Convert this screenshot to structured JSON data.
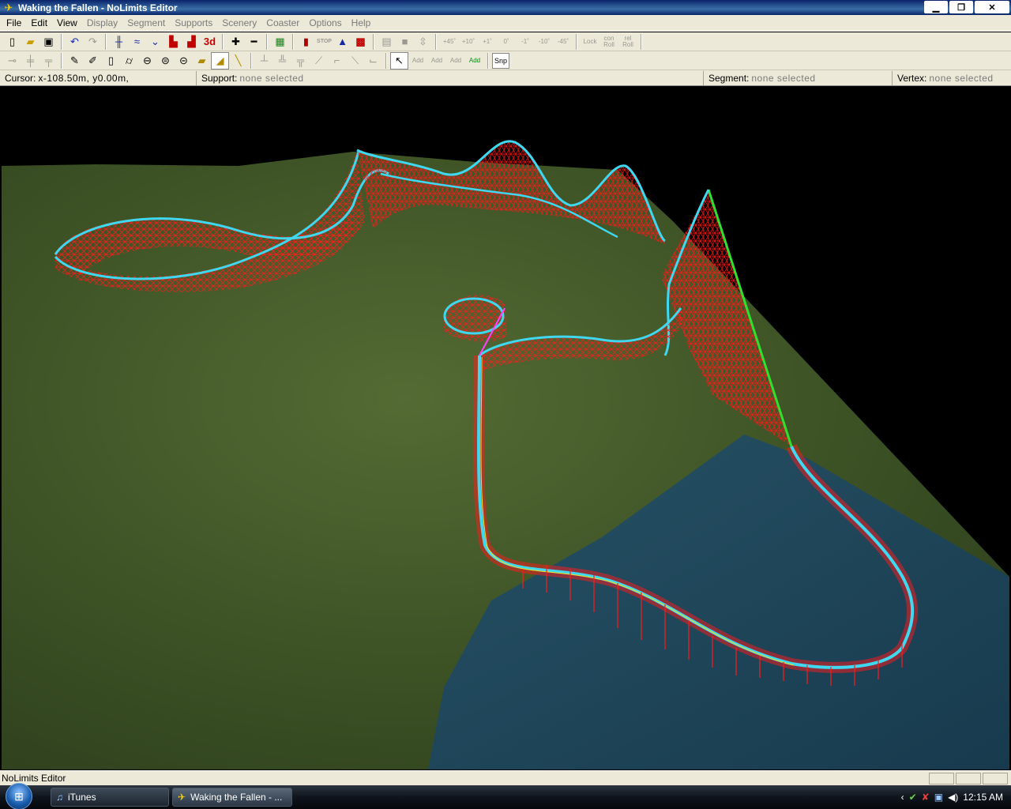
{
  "window": {
    "title": "Waking the Fallen - NoLimits Editor",
    "minimize": "▁",
    "restore": "❐",
    "close": "✕"
  },
  "menu": [
    "File",
    "Edit",
    "View",
    "Display",
    "Segment",
    "Supports",
    "Scenery",
    "Coaster",
    "Options",
    "Help"
  ],
  "toolbar1": {
    "new": "🗋",
    "open": "📂",
    "save": "💾",
    "undo": "↶",
    "redo": "↷",
    "three_d": "3d",
    "stop": "STOP",
    "lock_label": "Lock",
    "con_roll": "con Roll",
    "rel_roll": "rel Roll",
    "angles": [
      "+45˚",
      "+10˚",
      "+1˚",
      "0˚",
      "-1˚",
      "-10˚",
      "-45˚"
    ]
  },
  "toolbar2": {
    "add_labels": [
      "Add",
      "Add",
      "Add",
      "Add"
    ],
    "snap": "Snp"
  },
  "info": {
    "cursor_label": "Cursor:",
    "cursor_value": "x-108.50m, y0.00m,",
    "support_label": "Support:",
    "support_value": "none selected",
    "segment_label": "Segment:",
    "segment_value": "none selected",
    "vertex_label": "Vertex:",
    "vertex_value": "none selected"
  },
  "status": {
    "text": "NoLimits Editor"
  },
  "taskbar": {
    "items": [
      {
        "label": "iTunes"
      },
      {
        "label": "Waking the Fallen - ..."
      }
    ],
    "clock": "12:15 AM"
  },
  "colors": {
    "track_supports": "#ff1010",
    "track_rail": "#40d8f0",
    "lift_hill": "#30e030",
    "ground": "#3d5a26",
    "water": "#1c4a66"
  }
}
